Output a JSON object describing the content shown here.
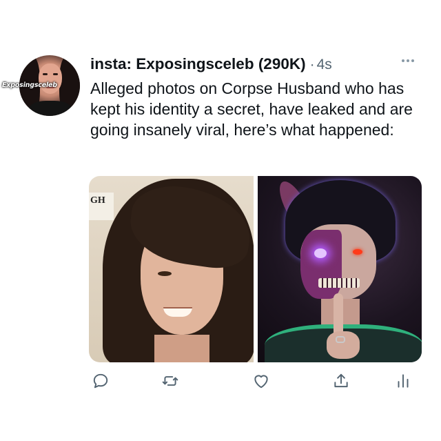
{
  "tweet": {
    "author": {
      "display_name": "insta: Exposingsceleb (290K)",
      "avatar_label": "Exposingsceleb"
    },
    "separator": "·",
    "timestamp": "4s",
    "text": "Alleged photos on Corpse Husband who has kept his identity a secret, have leaked and are going insanely viral, here’s what happened:",
    "media": {
      "left_photo_sign_text": "GH"
    },
    "actions": [
      {
        "name": "reply",
        "icon": "speech-bubble-icon"
      },
      {
        "name": "retweet",
        "icon": "retweet-icon"
      },
      {
        "name": "like",
        "icon": "heart-icon"
      },
      {
        "name": "share",
        "icon": "share-upload-icon"
      },
      {
        "name": "analytics",
        "icon": "bar-chart-icon"
      }
    ]
  },
  "colors": {
    "text_primary": "#0f1419",
    "text_secondary": "#536471",
    "icon_gray": "#536471"
  }
}
